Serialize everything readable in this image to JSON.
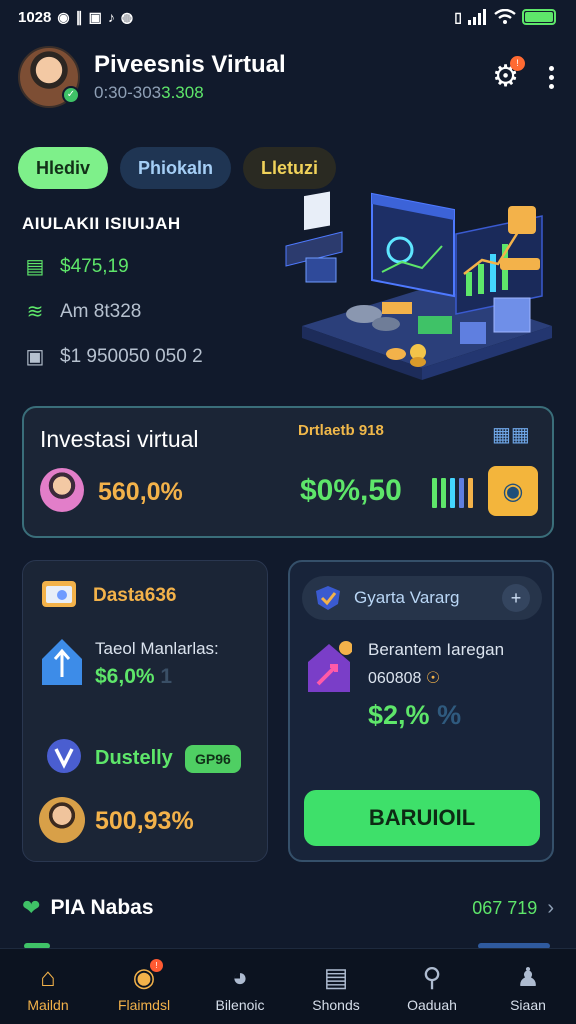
{
  "status_bar": {
    "time": "1028",
    "left_icons": [
      "notification-icon",
      "signal-icon",
      "image-icon",
      "sound-icon",
      "whatsapp-icon"
    ],
    "right_icons": [
      "vibrate-icon",
      "signal-bars-icon",
      "wifi-icon",
      "battery-icon"
    ]
  },
  "header": {
    "title": "Piveesnis Virtual",
    "subtitle_prefix": "0:30-303",
    "subtitle_suffix": "3.308",
    "notification_count": "!"
  },
  "chips": [
    {
      "label": "Hlediv"
    },
    {
      "label": "Phiokaln"
    },
    {
      "label": "Lletuzi"
    }
  ],
  "summary": {
    "heading": "AIULAKII ISIUIJAH",
    "rows": [
      {
        "icon": "wallet-icon",
        "text": "$475,19"
      },
      {
        "icon": "cash-stack-icon",
        "text": "Am 8t328"
      },
      {
        "icon": "safe-icon",
        "text": "$1 950050 050 2"
      }
    ]
  },
  "investasi_card": {
    "title": "Investasi virtual",
    "tag": "Drtlaetb 918",
    "percent": "560,0%",
    "value": "$0%,50"
  },
  "left_card": {
    "title": "Dasta636",
    "sub_label": "Taeol Manlarlas:",
    "sub_value": "$6,0%",
    "sub_value_trail": "1",
    "name": "Dustelly",
    "badge": "GP96",
    "percent": "500,93%"
  },
  "right_card": {
    "header_label": "Gyarta Vararg",
    "line1": "Berantem Iaregan",
    "line2": "060808",
    "value": "$2,%",
    "value_trail": "%",
    "button_label": "BARUIOIL"
  },
  "list_row": {
    "label": "PIA Nabas",
    "value": "067 719"
  },
  "bottom_nav": [
    {
      "label": "Maildn",
      "icon": "home-icon",
      "active": true
    },
    {
      "label": "Flaimdsl",
      "icon": "coins-icon",
      "active": true,
      "badge": "!"
    },
    {
      "label": "Bilenoic",
      "icon": "chart-coin-icon",
      "active": false
    },
    {
      "label": "Shonds",
      "icon": "ticket-icon",
      "active": false
    },
    {
      "label": "Oaduah",
      "icon": "search-doc-icon",
      "active": false
    },
    {
      "label": "Siaan",
      "icon": "user-icon",
      "active": false
    }
  ],
  "colors": {
    "background": "#111a2c",
    "accent_green": "#5ee66a",
    "accent_orange": "#f3b24a",
    "card": "#1b2536"
  }
}
